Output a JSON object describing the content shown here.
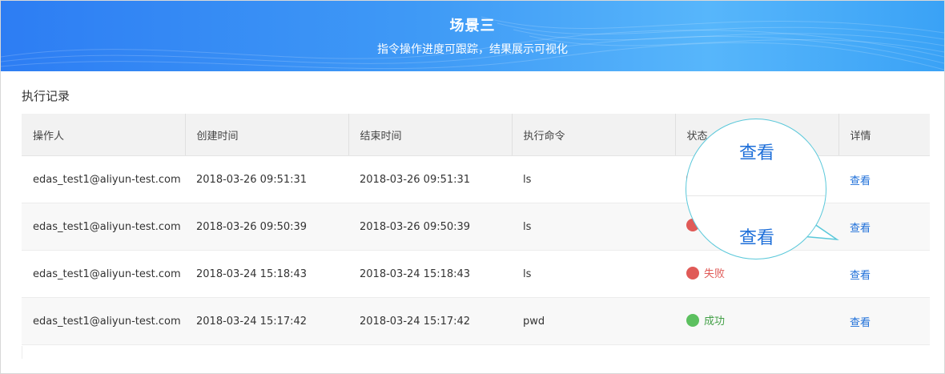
{
  "banner": {
    "title": "场景三",
    "subtitle": "指令操作进度可跟踪，结果展示可视化"
  },
  "section": {
    "title": "执行记录"
  },
  "table": {
    "columns": [
      "操作人",
      "创建时间",
      "结束时间",
      "执行命令",
      "状态",
      "详情"
    ],
    "rows": [
      {
        "operator": "edas_test1@aliyun-test.com",
        "created": "2018-03-26 09:51:31",
        "ended": "2018-03-26 09:51:31",
        "command": "ls",
        "status": "",
        "status_type": "fail",
        "detail": "查看"
      },
      {
        "operator": "edas_test1@aliyun-test.com",
        "created": "2018-03-26 09:50:39",
        "ended": "2018-03-26 09:50:39",
        "command": "ls",
        "status": "",
        "status_type": "fail",
        "detail": "查看"
      },
      {
        "operator": "edas_test1@aliyun-test.com",
        "created": "2018-03-24 15:18:43",
        "ended": "2018-03-24 15:18:43",
        "command": "ls",
        "status": "失败",
        "status_type": "fail",
        "detail": "查看"
      },
      {
        "operator": "edas_test1@aliyun-test.com",
        "created": "2018-03-24 15:17:42",
        "ended": "2018-03-24 15:17:42",
        "command": "pwd",
        "status": "成功",
        "status_type": "ok",
        "detail": "查看"
      }
    ]
  },
  "magnifier": {
    "top_text": "查看",
    "bottom_text": "查看"
  },
  "colors": {
    "link": "#1e6fd9",
    "fail": "#e05a57",
    "success": "#5cc05f",
    "banner_start": "#2d7df3",
    "banner_end": "#57b6fb",
    "callout_border": "#5ac8da"
  }
}
